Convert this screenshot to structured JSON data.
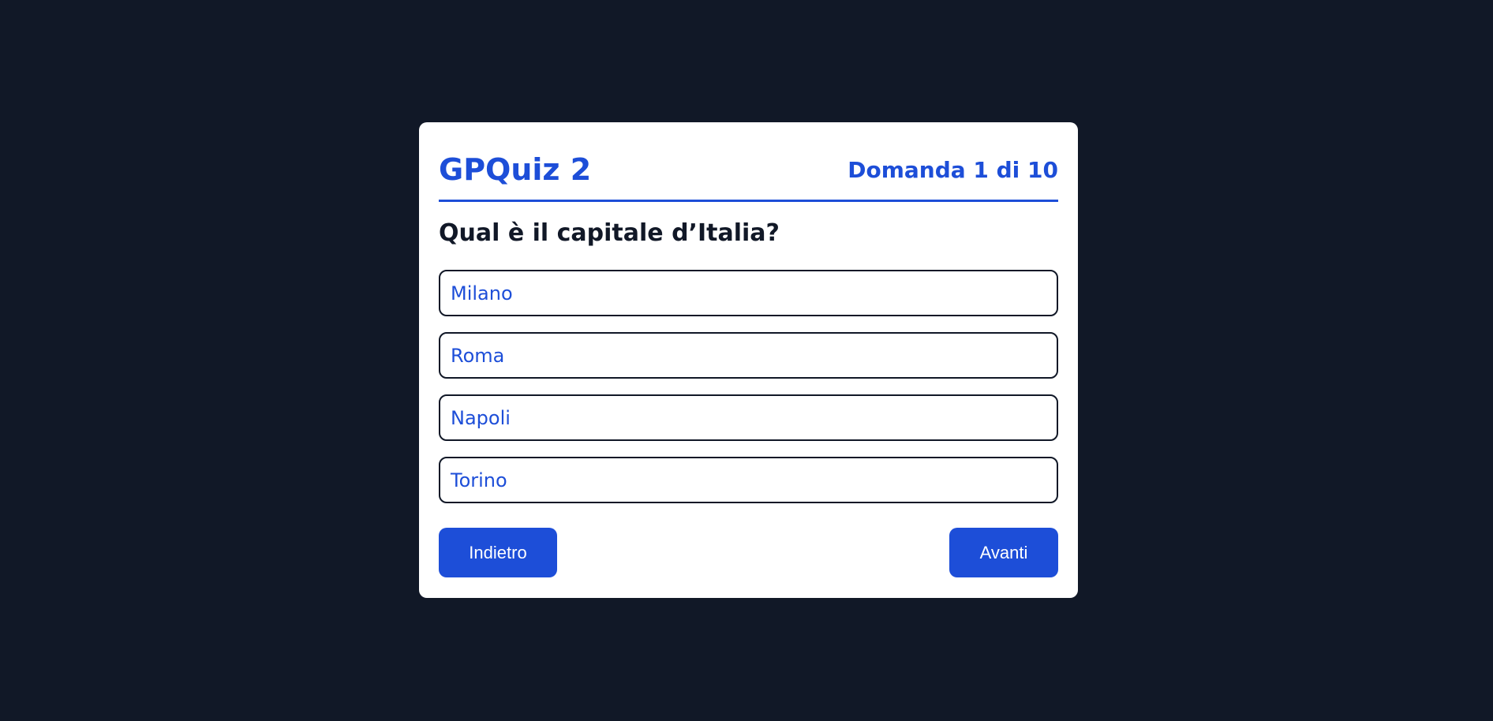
{
  "quiz": {
    "title": "GPQuiz 2",
    "counter": "Domanda 1 di 10",
    "question": "Qual è il capitale d’Italia?",
    "options": [
      {
        "label": "Milano"
      },
      {
        "label": "Roma"
      },
      {
        "label": "Napoli"
      },
      {
        "label": "Torino"
      }
    ],
    "back_label": "Indietro",
    "next_label": "Avanti"
  },
  "colors": {
    "background": "#111827",
    "card": "#ffffff",
    "accent": "#1d4ed8",
    "text": "#111827"
  }
}
